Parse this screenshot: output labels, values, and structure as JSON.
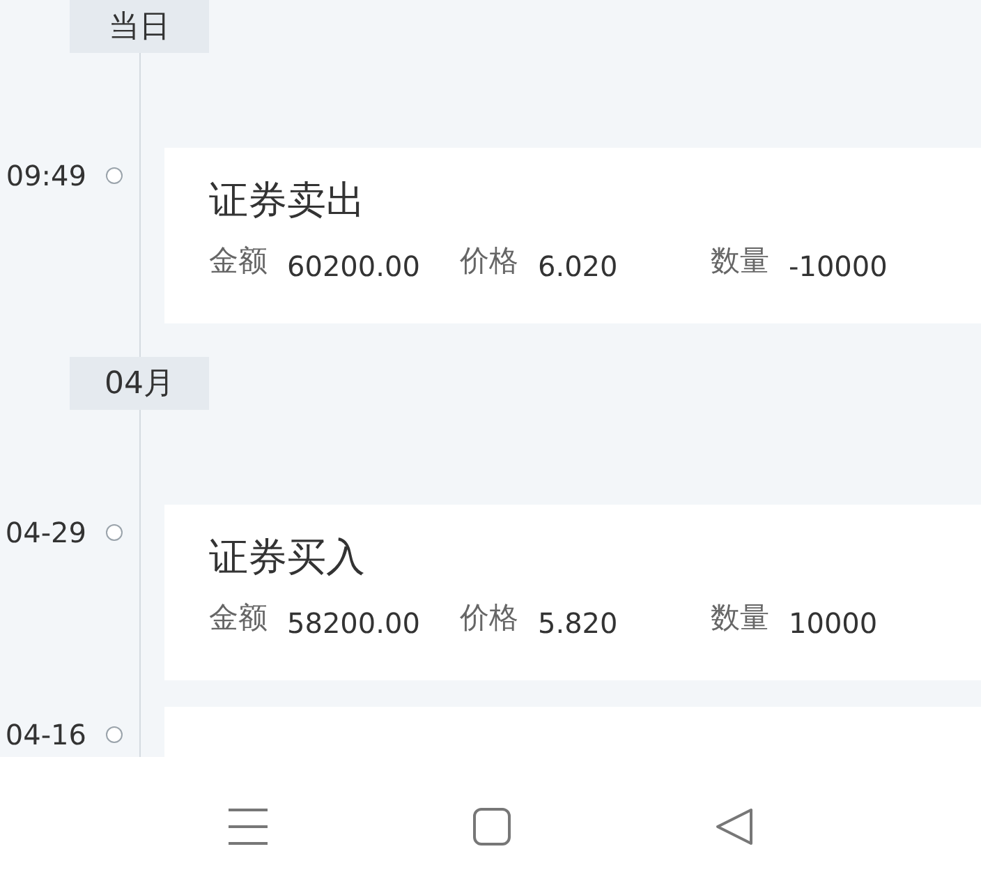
{
  "timeline": [
    {
      "kind": "section",
      "label": "当日"
    },
    {
      "kind": "entry",
      "time": "09:49",
      "title": "证券卖出",
      "fields": [
        {
          "label": "金额",
          "value": "60200.00"
        },
        {
          "label": "价格",
          "value": "6.020"
        },
        {
          "label": "数量",
          "value": "-10000"
        }
      ]
    },
    {
      "kind": "section",
      "label": "04月"
    },
    {
      "kind": "entry",
      "time": "04-29",
      "title": "证券买入",
      "fields": [
        {
          "label": "金额",
          "value": "58200.00"
        },
        {
          "label": "价格",
          "value": "5.820"
        },
        {
          "label": "数量",
          "value": "10000"
        }
      ]
    },
    {
      "kind": "entry",
      "time": "04-16"
    }
  ]
}
